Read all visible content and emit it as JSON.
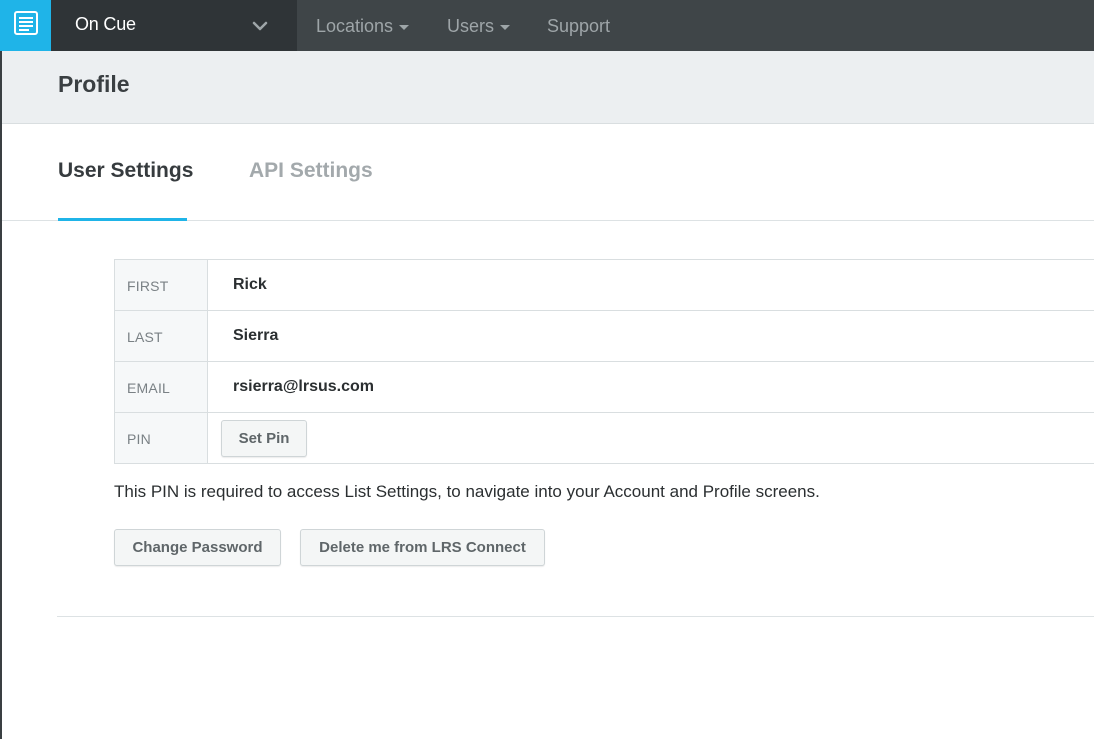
{
  "topbar": {
    "logo_icon": "list-document-icon",
    "account_name": "On Cue",
    "account_chevron_icon": "chevron-down-icon",
    "nav": [
      {
        "label": "Locations",
        "has_dropdown": true
      },
      {
        "label": "Users",
        "has_dropdown": true
      },
      {
        "label": "Support",
        "has_dropdown": false
      }
    ]
  },
  "page": {
    "title": "Profile"
  },
  "tabs": [
    {
      "label": "User Settings",
      "active": true
    },
    {
      "label": "API Settings",
      "active": false
    }
  ],
  "profile": {
    "fields": [
      {
        "label": "FIRST",
        "value": "Rick"
      },
      {
        "label": "LAST",
        "value": "Sierra"
      },
      {
        "label": "EMAIL",
        "value": "rsierra@lrsus.com"
      },
      {
        "label": "PIN",
        "button_label": "Set Pin"
      }
    ],
    "pin_note": "This PIN is required to access List Settings, to navigate into your Account and Profile screens."
  },
  "actions": {
    "change_password": "Change Password",
    "delete_account": "Delete me from LRS Connect"
  },
  "colors": {
    "accent": "#1fb4e8",
    "topbar": "#3f4548",
    "account_selector": "#2f3437",
    "header_bg": "#eceff1"
  }
}
